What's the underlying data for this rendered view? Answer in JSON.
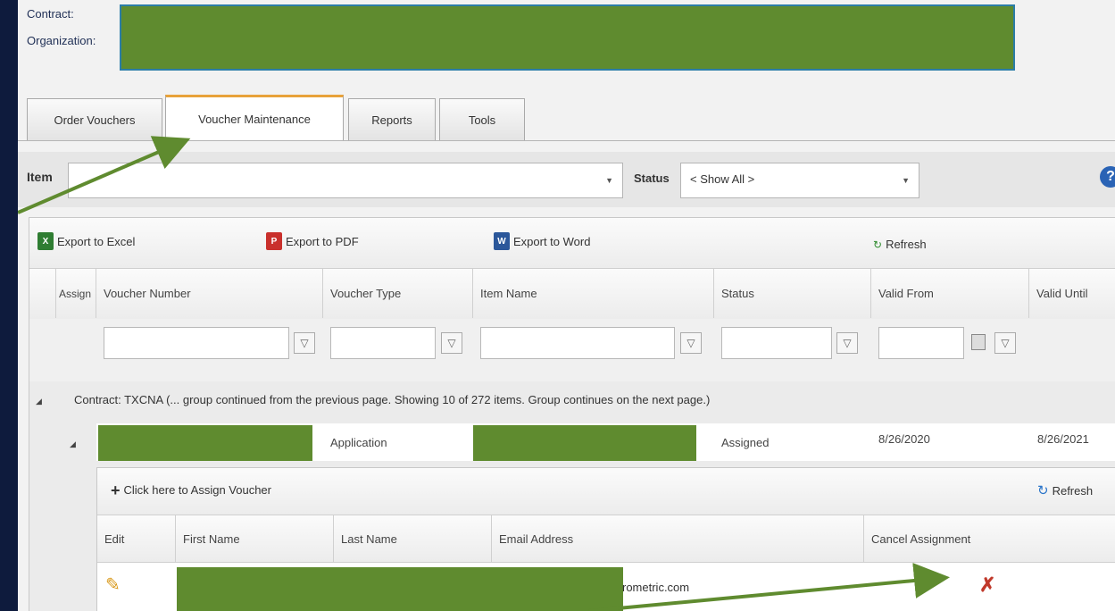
{
  "header": {
    "contract_label": "Contract:",
    "organization_label": "Organization:"
  },
  "tabs": [
    {
      "label": "Order Vouchers"
    },
    {
      "label": "Voucher Maintenance"
    },
    {
      "label": "Reports"
    },
    {
      "label": "Tools"
    }
  ],
  "filters": {
    "item_label": "Item",
    "item_value": "",
    "status_label": "Status",
    "status_value": "< Show All >",
    "help_icon": "question-circle-icon"
  },
  "toolbar": {
    "excel": "Export to Excel",
    "pdf": "Export to PDF",
    "word": "Export to Word",
    "refresh": "Refresh"
  },
  "grid": {
    "columns": [
      "Assign",
      "Voucher Number",
      "Voucher Type",
      "Item Name",
      "Status",
      "Valid From",
      "Valid Until"
    ],
    "group_text": "Contract: TXCNA (... group continued from the previous page. Showing 10 of 272 items. Group continues on the next page.)",
    "row": {
      "voucher_type": "Application",
      "status": "Assigned",
      "valid_from": "8/26/2020",
      "valid_until": "8/26/2021"
    }
  },
  "detail": {
    "assign_label": "Click here to Assign Voucher",
    "refresh_label": "Refresh",
    "columns": [
      "Edit",
      "First Name",
      "Last Name",
      "Email Address",
      "Cancel Assignment"
    ],
    "row": {
      "email_tail": "rometric.com"
    }
  },
  "colors": {
    "accent_tab": "#e8a23a",
    "redaction": "#5f8b2f",
    "arrow": "#5f8b2f",
    "background": "#0e1b3d"
  }
}
